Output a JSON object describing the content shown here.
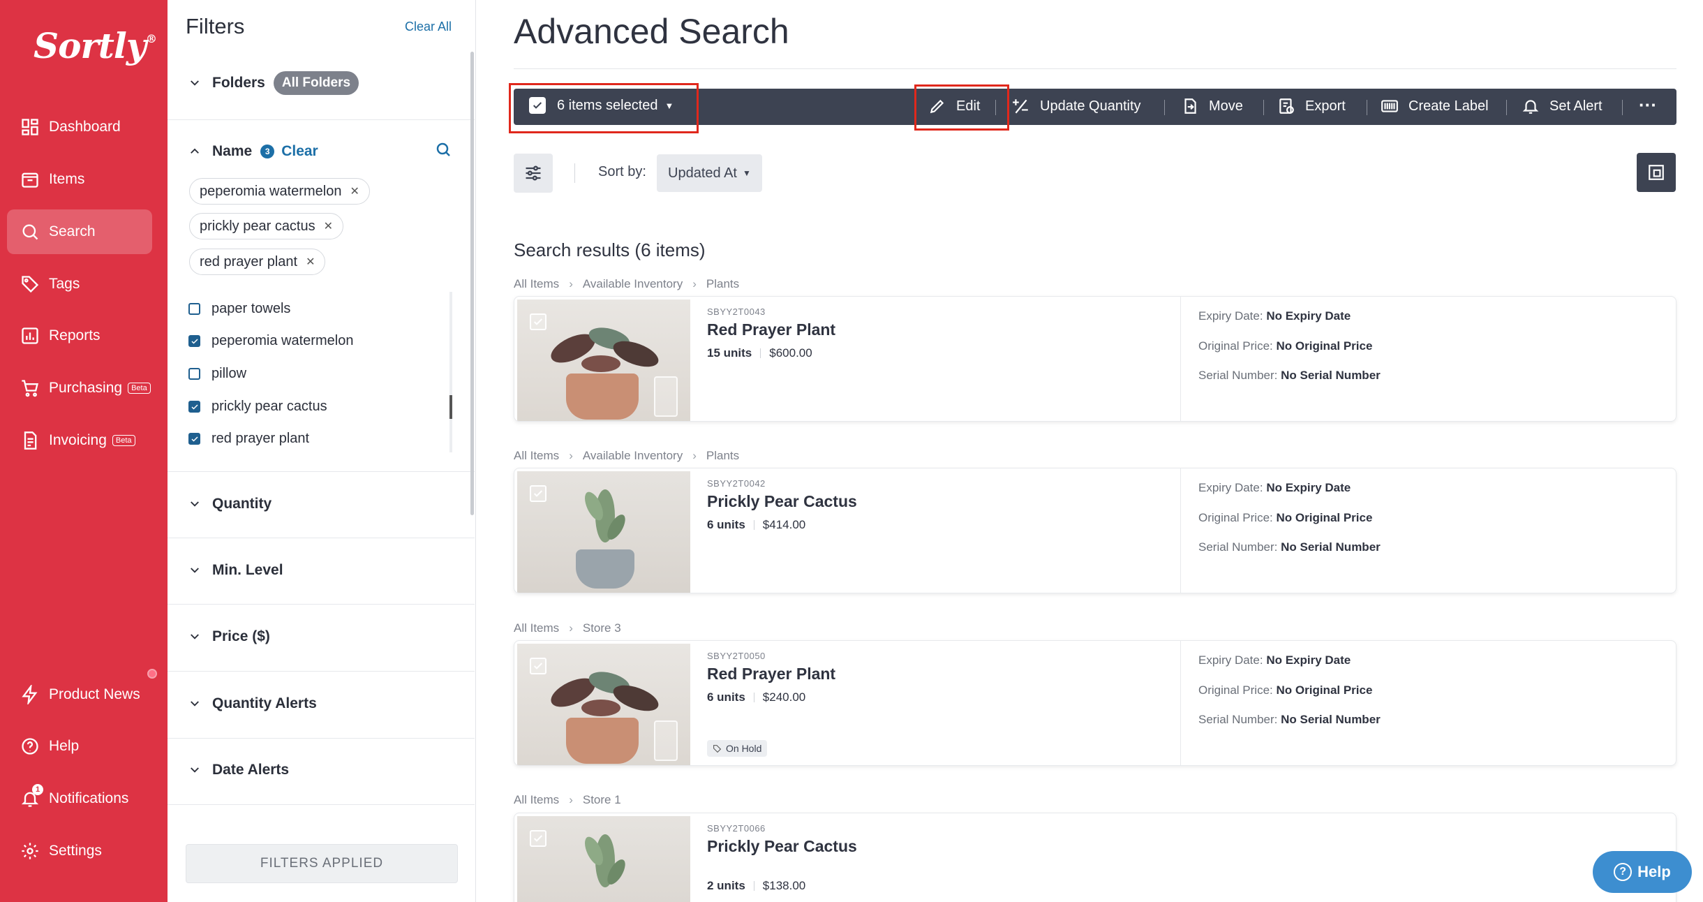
{
  "brand": {
    "logo": "Sortly",
    "reg": "®"
  },
  "nav": {
    "dashboard": "Dashboard",
    "items": "Items",
    "search": "Search",
    "tags": "Tags",
    "reports": "Reports",
    "purchasing": "Purchasing",
    "invoicing": "Invoicing",
    "beta": "Beta",
    "product_news": "Product News",
    "help": "Help",
    "notifications": "Notifications",
    "notifications_count": "1",
    "settings": "Settings"
  },
  "filters": {
    "title": "Filters",
    "clear_all": "Clear All",
    "folders_label": "Folders",
    "folders_value": "All Folders",
    "name_label": "Name",
    "name_count": "3",
    "name_clear": "Clear",
    "chips": [
      "peperomia watermelon",
      "prickly pear cactus",
      "red prayer plant"
    ],
    "options": [
      {
        "label": "paper towels",
        "checked": false
      },
      {
        "label": "peperomia watermelon",
        "checked": true
      },
      {
        "label": "pillow",
        "checked": false
      },
      {
        "label": "prickly pear cactus",
        "checked": true
      },
      {
        "label": "red prayer plant",
        "checked": true
      }
    ],
    "sections": [
      "Quantity",
      "Min. Level",
      "Price ($)",
      "Quantity Alerts",
      "Date Alerts"
    ],
    "applied_label": "FILTERS APPLIED"
  },
  "main": {
    "title": "Advanced Search",
    "toolbar": {
      "selected": "6 items selected",
      "edit": "Edit",
      "update_quantity": "Update Quantity",
      "move": "Move",
      "export": "Export",
      "create_label": "Create Label",
      "set_alert": "Set Alert",
      "more": "···"
    },
    "sort_label": "Sort by:",
    "sort_value": "Updated At",
    "results_title": "Search results (6 items)",
    "attr_labels": {
      "expiry": "Expiry Date:",
      "original_price": "Original Price:",
      "serial": "Serial Number:"
    },
    "items": [
      {
        "crumbs": [
          "All Items",
          "Available Inventory",
          "Plants"
        ],
        "sku": "SBYY2T0043",
        "name": "Red Prayer Plant",
        "qty": "15 units",
        "price": "$600.00",
        "tag": "",
        "expiry": "No Expiry Date",
        "original_price": "No Original Price",
        "serial": "No Serial Number"
      },
      {
        "crumbs": [
          "All Items",
          "Available Inventory",
          "Plants"
        ],
        "sku": "SBYY2T0042",
        "name": "Prickly Pear Cactus",
        "qty": "6 units",
        "price": "$414.00",
        "tag": "",
        "expiry": "No Expiry Date",
        "original_price": "No Original Price",
        "serial": "No Serial Number"
      },
      {
        "crumbs": [
          "All Items",
          "Store 3"
        ],
        "sku": "SBYY2T0050",
        "name": "Red Prayer Plant",
        "qty": "6 units",
        "price": "$240.00",
        "tag": "On Hold",
        "expiry": "No Expiry Date",
        "original_price": "No Original Price",
        "serial": "No Serial Number"
      },
      {
        "crumbs": [
          "All Items",
          "Store 1"
        ],
        "sku": "SBYY2T0066",
        "name": "Prickly Pear Cactus",
        "qty": "2 units",
        "price": "$138.00",
        "tag": "",
        "expiry": "",
        "original_price": "",
        "serial": ""
      }
    ]
  },
  "help_button": "Help",
  "colors": {
    "brand": "#dd3344",
    "toolbar": "#3d4352",
    "link": "#1c6fa7",
    "highlight": "#e0281c"
  }
}
